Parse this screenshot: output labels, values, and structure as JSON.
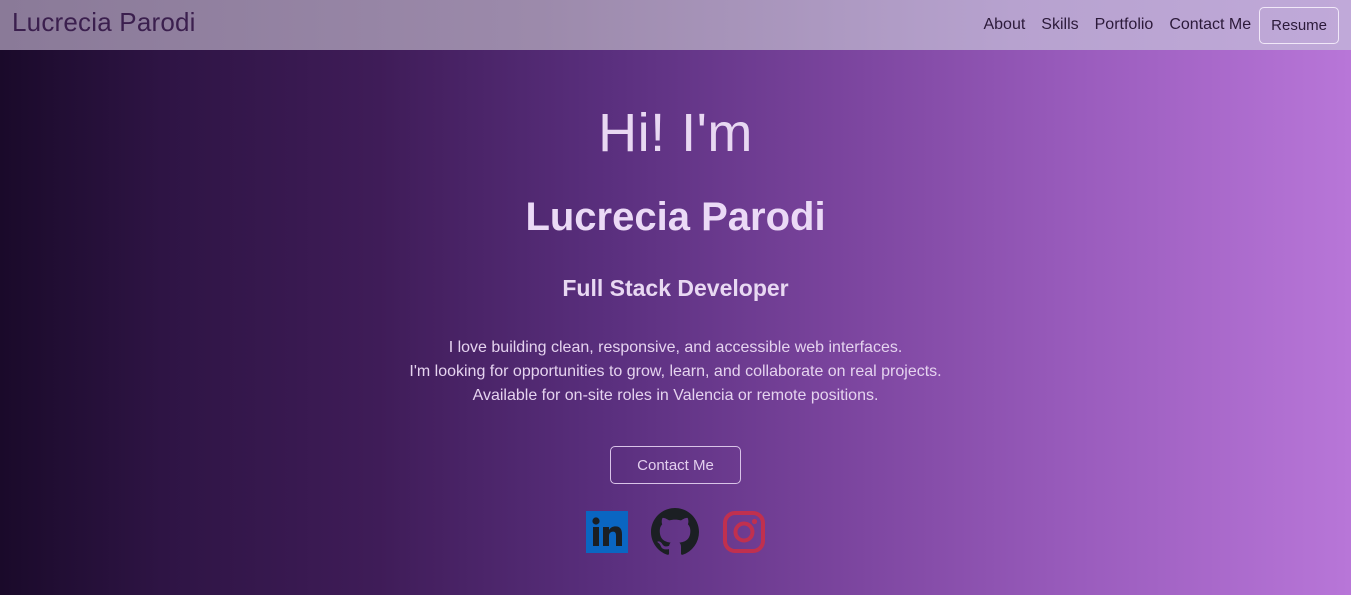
{
  "navbar": {
    "brand": "Lucrecia Parodi",
    "links": [
      "About",
      "Skills",
      "Portfolio",
      "Contact Me"
    ],
    "resume_label": "Resume"
  },
  "hero": {
    "greeting": "Hi! I'm",
    "name": "Lucrecia Parodi",
    "role": "Full Stack Developer",
    "lines": [
      "I love building clean, responsive, and accessible web interfaces.",
      "I'm looking for opportunities to grow, learn, and collaborate on real projects.",
      "Available for on-site roles in Valencia or remote positions."
    ],
    "contact_label": "Contact Me"
  },
  "social": {
    "icons": [
      "linkedin-icon",
      "github-icon",
      "instagram-icon"
    ]
  },
  "colors": {
    "linkedin": "#0a66c2",
    "github": "#1b1f23",
    "instagram": "#c0304f"
  }
}
